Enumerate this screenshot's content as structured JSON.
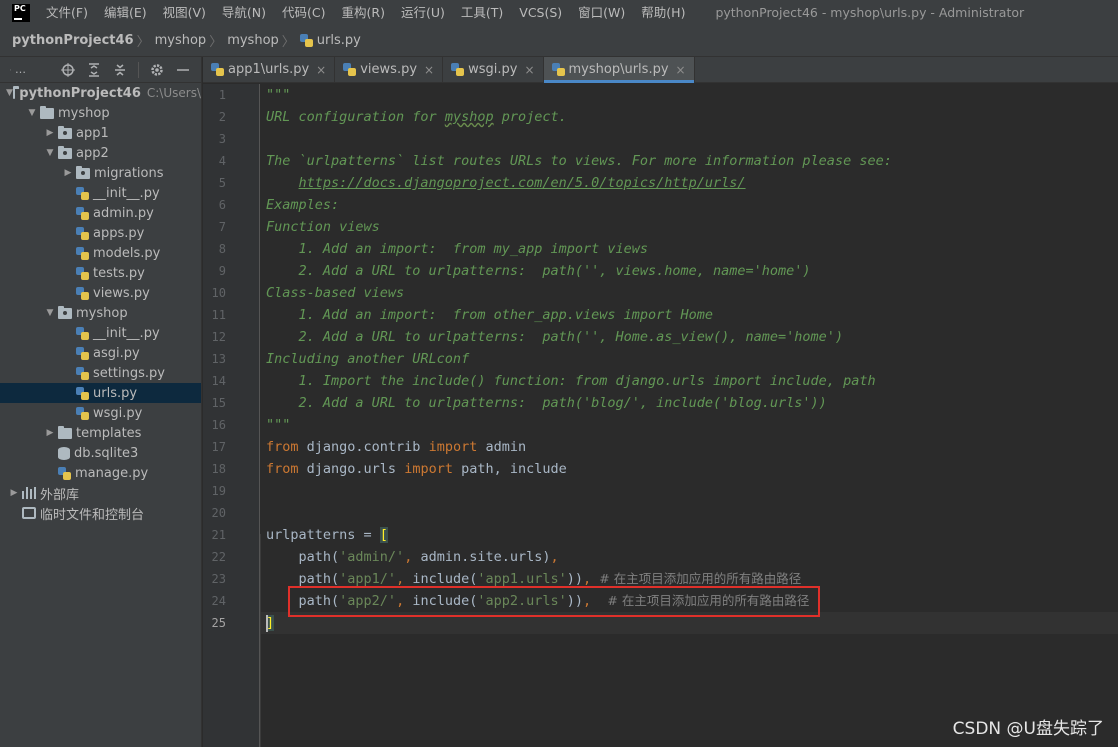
{
  "app": {
    "logo_text": "PC",
    "menu": [
      "文件(F)",
      "编辑(E)",
      "视图(V)",
      "导航(N)",
      "代码(C)",
      "重构(R)",
      "运行(U)",
      "工具(T)",
      "VCS(S)",
      "窗口(W)",
      "帮助(H)"
    ],
    "window_title": "pythonProject46 - myshop\\urls.py - Administrator"
  },
  "breadcrumb": [
    "pythonProject46",
    "myshop",
    "myshop",
    "urls.py"
  ],
  "panel": {
    "title_short": "…",
    "icons": [
      "project-icon",
      "target-icon",
      "expand-all-icon",
      "collapse-all-icon",
      "gear-icon",
      "minimize-icon"
    ]
  },
  "tree": [
    {
      "label": "pythonProject46",
      "hint": "C:\\Users\\",
      "level": 0,
      "arrow": "down",
      "icon": "folder",
      "bold": true
    },
    {
      "label": "myshop",
      "level": 1,
      "arrow": "down",
      "icon": "folder"
    },
    {
      "label": "app1",
      "level": 2,
      "arrow": "right",
      "icon": "folder-pkg"
    },
    {
      "label": "app2",
      "level": 2,
      "arrow": "down",
      "icon": "folder-pkg"
    },
    {
      "label": "migrations",
      "level": 3,
      "arrow": "right",
      "icon": "folder-pkg"
    },
    {
      "label": "__init__.py",
      "level": 3,
      "icon": "py"
    },
    {
      "label": "admin.py",
      "level": 3,
      "icon": "py"
    },
    {
      "label": "apps.py",
      "level": 3,
      "icon": "py"
    },
    {
      "label": "models.py",
      "level": 3,
      "icon": "py"
    },
    {
      "label": "tests.py",
      "level": 3,
      "icon": "py"
    },
    {
      "label": "views.py",
      "level": 3,
      "icon": "py"
    },
    {
      "label": "myshop",
      "level": 2,
      "arrow": "down",
      "icon": "folder-pkg"
    },
    {
      "label": "__init__.py",
      "level": 3,
      "icon": "py"
    },
    {
      "label": "asgi.py",
      "level": 3,
      "icon": "py"
    },
    {
      "label": "settings.py",
      "level": 3,
      "icon": "py"
    },
    {
      "label": "urls.py",
      "level": 3,
      "icon": "py",
      "selected": true
    },
    {
      "label": "wsgi.py",
      "level": 3,
      "icon": "py"
    },
    {
      "label": "templates",
      "level": 2,
      "arrow": "right",
      "icon": "folder"
    },
    {
      "label": "db.sqlite3",
      "level": 2,
      "icon": "db"
    },
    {
      "label": "manage.py",
      "level": 2,
      "icon": "py"
    },
    {
      "label": "外部库",
      "level": 0,
      "arrow": "right",
      "icon": "lib"
    },
    {
      "label": "临时文件和控制台",
      "level": 0,
      "icon": "scratch"
    }
  ],
  "tabs": [
    {
      "label": "app1\\urls.py",
      "close": "×",
      "active": false
    },
    {
      "label": "views.py",
      "close": "×",
      "active": false
    },
    {
      "label": "wsgi.py",
      "close": "×",
      "active": false
    },
    {
      "label": "myshop\\urls.py",
      "close": "×",
      "active": true
    }
  ],
  "editor": {
    "current_line": 25,
    "lines": [
      [
        [
          "doc",
          "\"\"\""
        ]
      ],
      [
        [
          "doc",
          "URL configuration for "
        ],
        [
          "doc-typo",
          "myshop"
        ],
        [
          "doc",
          " project."
        ]
      ],
      [],
      [
        [
          "doc",
          "The `urlpatterns` list routes URLs to views. For more information please see:"
        ]
      ],
      [
        [
          "doc",
          "    "
        ],
        [
          "doc-link",
          "https://docs.djangoproject.com/en/5.0/topics/http/urls/"
        ]
      ],
      [
        [
          "doc",
          "Examples:"
        ]
      ],
      [
        [
          "doc",
          "Function views"
        ]
      ],
      [
        [
          "doc",
          "    1. Add an import:  from my_app import views"
        ]
      ],
      [
        [
          "doc",
          "    2. Add a URL to urlpatterns:  path('', views.home, name='home')"
        ]
      ],
      [
        [
          "doc",
          "Class-based views"
        ]
      ],
      [
        [
          "doc",
          "    1. Add an import:  from other_app.views import Home"
        ]
      ],
      [
        [
          "doc",
          "    2. Add a URL to urlpatterns:  path('', Home.as_view(), name='home')"
        ]
      ],
      [
        [
          "doc",
          "Including another URLconf"
        ]
      ],
      [
        [
          "doc",
          "    1. Import the include() function: from django.urls import include, path"
        ]
      ],
      [
        [
          "doc",
          "    2. Add a URL to urlpatterns:  path('blog/', include('blog.urls'))"
        ]
      ],
      [
        [
          "doc",
          "\"\"\""
        ]
      ],
      [
        [
          "kw",
          "from"
        ],
        [
          "plain",
          " django.contrib "
        ],
        [
          "kw",
          "import"
        ],
        [
          "plain",
          " admin"
        ]
      ],
      [
        [
          "kw",
          "from"
        ],
        [
          "plain",
          " django.urls "
        ],
        [
          "kw",
          "import"
        ],
        [
          "plain",
          " path, include"
        ]
      ],
      [],
      [],
      [
        [
          "plain",
          "urlpatterns = "
        ],
        [
          "bracket-hl",
          "["
        ]
      ],
      [
        [
          "plain",
          "    path("
        ],
        [
          "str",
          "'admin/'"
        ],
        [
          "kw",
          ", "
        ],
        [
          "plain",
          "admin.site.urls)"
        ],
        [
          "kw",
          ","
        ]
      ],
      [
        [
          "plain",
          "    path("
        ],
        [
          "str",
          "'app1/'"
        ],
        [
          "kw",
          ", "
        ],
        [
          "plain",
          "include("
        ],
        [
          "str",
          "'app1.urls'"
        ],
        [
          "plain",
          "))"
        ],
        [
          "kw",
          ", "
        ],
        [
          "cmt",
          "# 在主项目添加应用的所有路由路径"
        ]
      ],
      [
        [
          "plain",
          "    path("
        ],
        [
          "str",
          "'app2/'"
        ],
        [
          "kw",
          ", "
        ],
        [
          "plain",
          "include("
        ],
        [
          "str",
          "'app2.urls'"
        ],
        [
          "plain",
          "))"
        ],
        [
          "kw",
          ",  "
        ],
        [
          "cmt",
          "# 在主项目添加应用的所有路由路径"
        ]
      ],
      [
        [
          "bracket-hl",
          "]"
        ]
      ]
    ]
  },
  "watermark": "CSDN @U盘失踪了",
  "colors": {
    "menubar_bg": "#3c3f41",
    "editor_bg": "#2b2b2b",
    "docstring": "#629755",
    "keyword": "#cc7832",
    "string": "#6a8759",
    "highlight_box": "#e0302a"
  }
}
